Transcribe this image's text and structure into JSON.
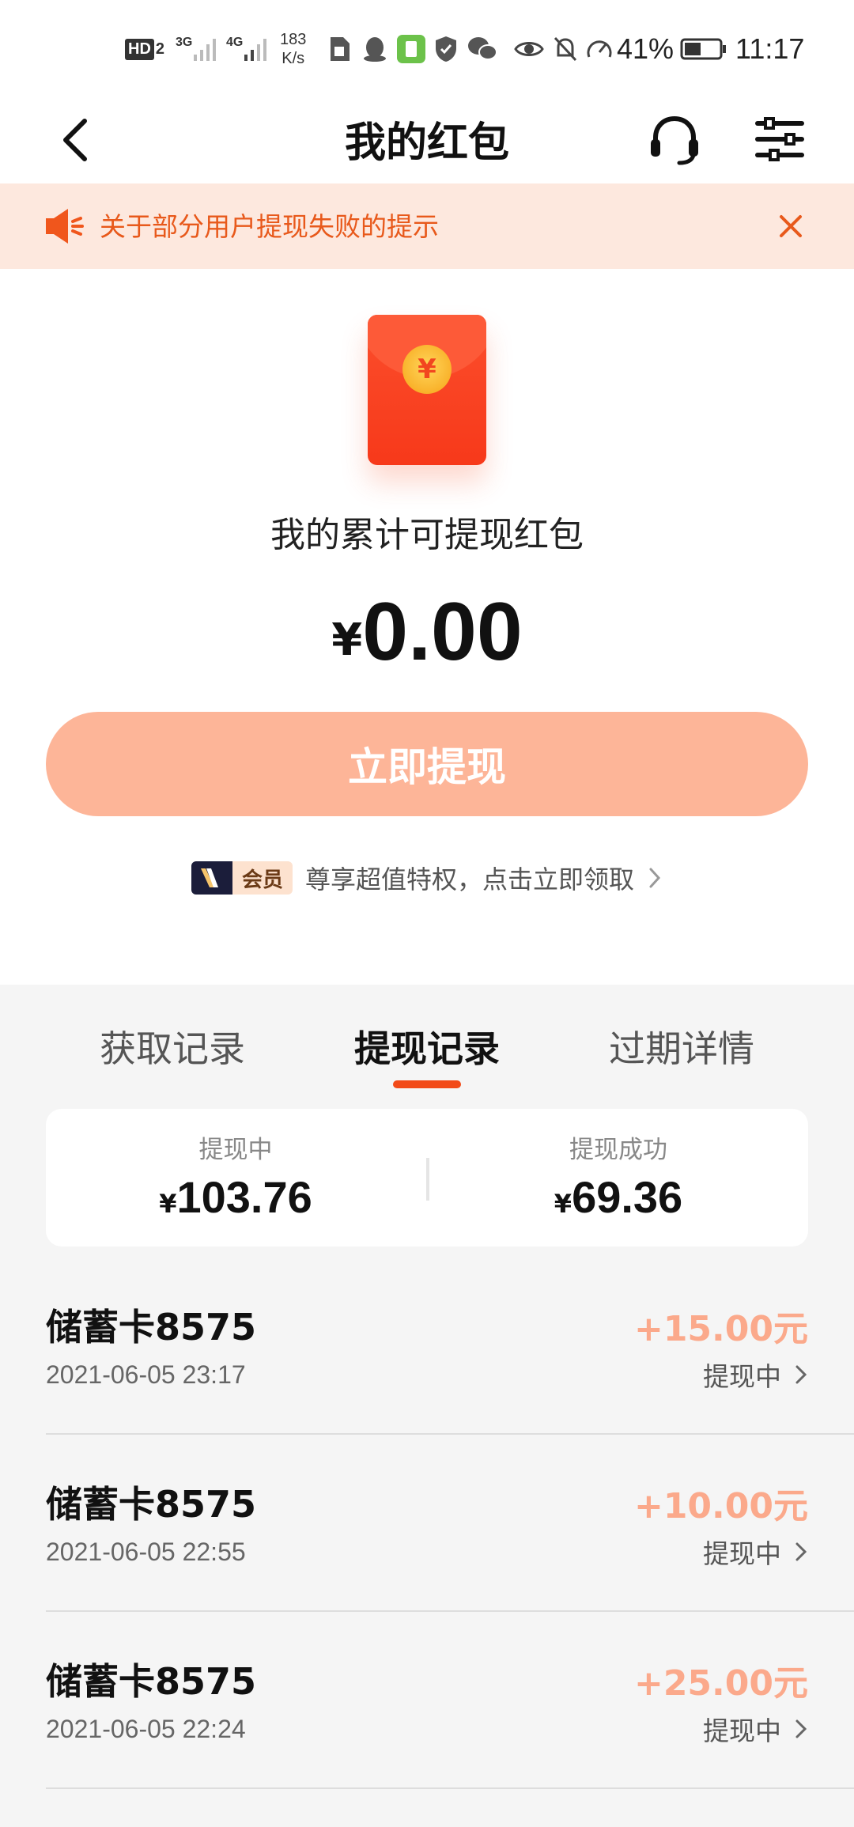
{
  "status_bar": {
    "hd": "HD",
    "hd_sub": "2",
    "net1": "3G",
    "net2": "4G",
    "speed_value": "183",
    "speed_unit": "K/s",
    "battery": "41%",
    "time": "11:17"
  },
  "header": {
    "title": "我的红包"
  },
  "notice": {
    "text": "关于部分用户提现失败的提示"
  },
  "wallet": {
    "coin_symbol": "¥",
    "cumulative_label": "我的累计可提现红包",
    "currency": "¥",
    "balance": "0.00",
    "withdraw_button": "立即提现",
    "vip_badge": "会员",
    "vip_text": "尊享超值特权，点击立即领取"
  },
  "tabs": [
    {
      "label": "获取记录",
      "active": false
    },
    {
      "label": "提现记录",
      "active": true
    },
    {
      "label": "过期详情",
      "active": false
    }
  ],
  "summary": {
    "pending_label": "提现中",
    "pending_currency": "¥",
    "pending_value": "103.76",
    "success_label": "提现成功",
    "success_currency": "¥",
    "success_value": "69.36"
  },
  "records": [
    {
      "name": "储蓄卡8575",
      "time": "2021-06-05 23:17",
      "amount": "+15.00元",
      "status": "提现中"
    },
    {
      "name": "储蓄卡8575",
      "time": "2021-06-05 22:55",
      "amount": "+10.00元",
      "status": "提现中"
    },
    {
      "name": "储蓄卡8575",
      "time": "2021-06-05 22:24",
      "amount": "+25.00元",
      "status": "提现中"
    }
  ],
  "colors": {
    "accent": "#f24a18",
    "notice_bg": "#fde8de",
    "button_bg": "#fdb598",
    "amount_text": "#fba98b"
  }
}
